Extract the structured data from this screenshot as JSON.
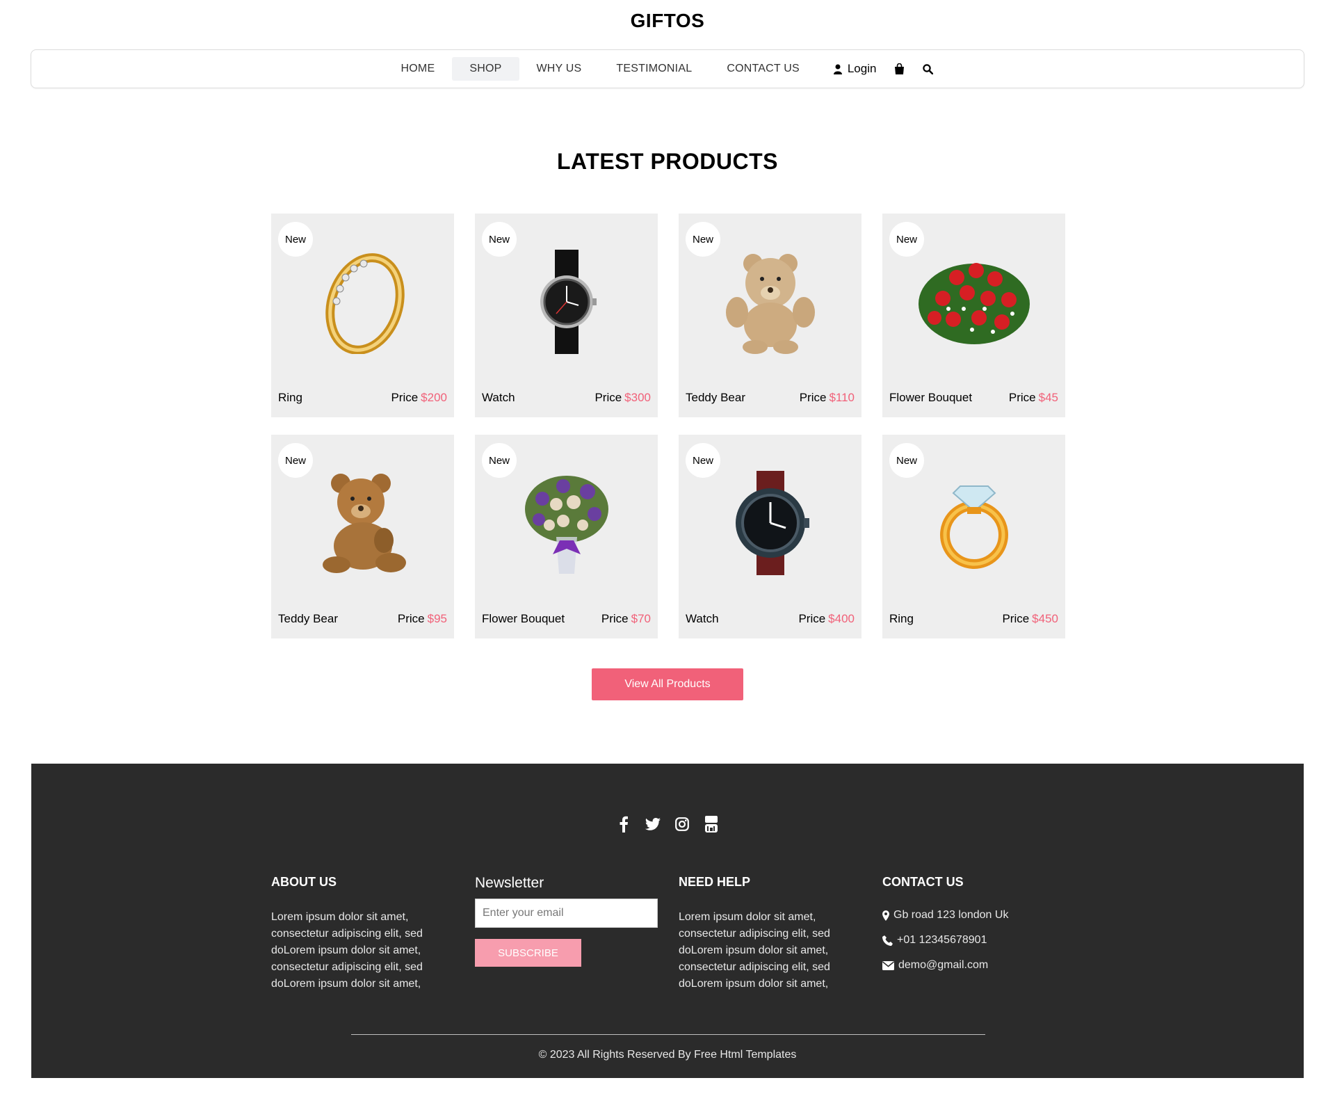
{
  "brand": "GIFTOS",
  "nav": {
    "items": [
      "HOME",
      "SHOP",
      "WHY US",
      "TESTIMONIAL",
      "CONTACT US"
    ],
    "active": "SHOP",
    "login_label": "Login"
  },
  "section": {
    "title": "LATEST PRODUCTS",
    "badge": "New",
    "price_label": "Price",
    "view_all_label": "View All Products"
  },
  "products": [
    {
      "name": "Ring",
      "price": "$200",
      "image": "gold-ring"
    },
    {
      "name": "Watch",
      "price": "$300",
      "image": "black-watch"
    },
    {
      "name": "Teddy Bear",
      "price": "$110",
      "image": "teddy-bear"
    },
    {
      "name": "Flower Bouquet",
      "price": "$45",
      "image": "red-roses"
    },
    {
      "name": "Teddy Bear",
      "price": "$95",
      "image": "brown-teddy"
    },
    {
      "name": "Flower Bouquet",
      "price": "$70",
      "image": "purple-bouquet"
    },
    {
      "name": "Watch",
      "price": "$400",
      "image": "leather-watch"
    },
    {
      "name": "Ring",
      "price": "$450",
      "image": "diamond-ring"
    }
  ],
  "footer": {
    "socials": [
      "facebook-icon",
      "twitter-icon",
      "instagram-icon",
      "youtube-icon"
    ],
    "about": {
      "title": "ABOUT US",
      "text": "Lorem ipsum dolor sit amet, consectetur adipiscing elit, sed doLorem ipsum dolor sit amet, consectetur adipiscing elit, sed doLorem ipsum dolor sit amet,"
    },
    "newsletter": {
      "title": "Newsletter",
      "placeholder": "Enter your email",
      "button": "SUBSCRIBE"
    },
    "help": {
      "title": "NEED HELP",
      "text": "Lorem ipsum dolor sit amet, consectetur adipiscing elit, sed doLorem ipsum dolor sit amet, consectetur adipiscing elit, sed doLorem ipsum dolor sit amet,"
    },
    "contact": {
      "title": "CONTACT US",
      "address": "Gb road 123 london Uk",
      "phone": "+01 12345678901",
      "email": "demo@gmail.com"
    },
    "copyright": "© 2023 All Rights Reserved By Free Html Templates"
  },
  "colors": {
    "accent": "#f16179",
    "subscribe": "#f79dae",
    "footer_bg": "#2b2b2b",
    "card_bg": "#eeeeee"
  }
}
